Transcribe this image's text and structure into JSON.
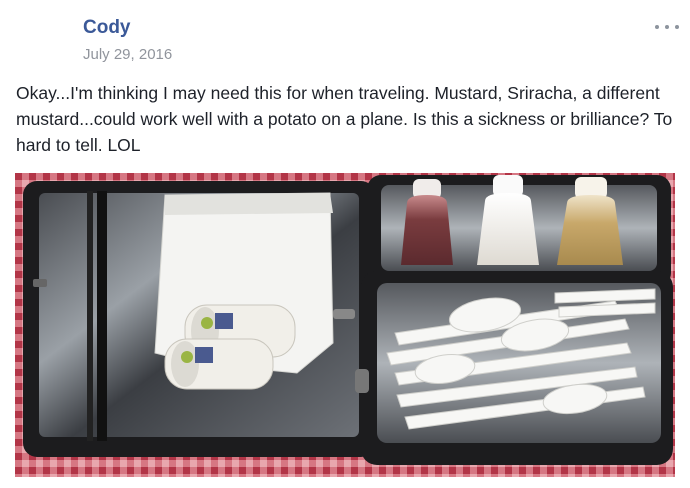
{
  "post": {
    "author": "Cody",
    "date": "July 29, 2016",
    "text": "Okay...I'm thinking I may need this for when traveling. Mustard, Sriracha, a different mustard...could work well with a potato on a plane. Is this a sickness or brilliance? To hard to tell. LOL",
    "more_icon": "ellipsis-horizontal-icon"
  },
  "photo": {
    "subject": "zippered travel kit with paper napkins, three condiment squeeze bottles and plastic cutlery on a red gingham tablecloth",
    "colors": {
      "tablecloth": "#c75060",
      "case": "#1c1c1e",
      "sriracha": "#7a3c3f",
      "white_condiment": "#ece8e0",
      "mustard": "#c8a86a"
    }
  }
}
